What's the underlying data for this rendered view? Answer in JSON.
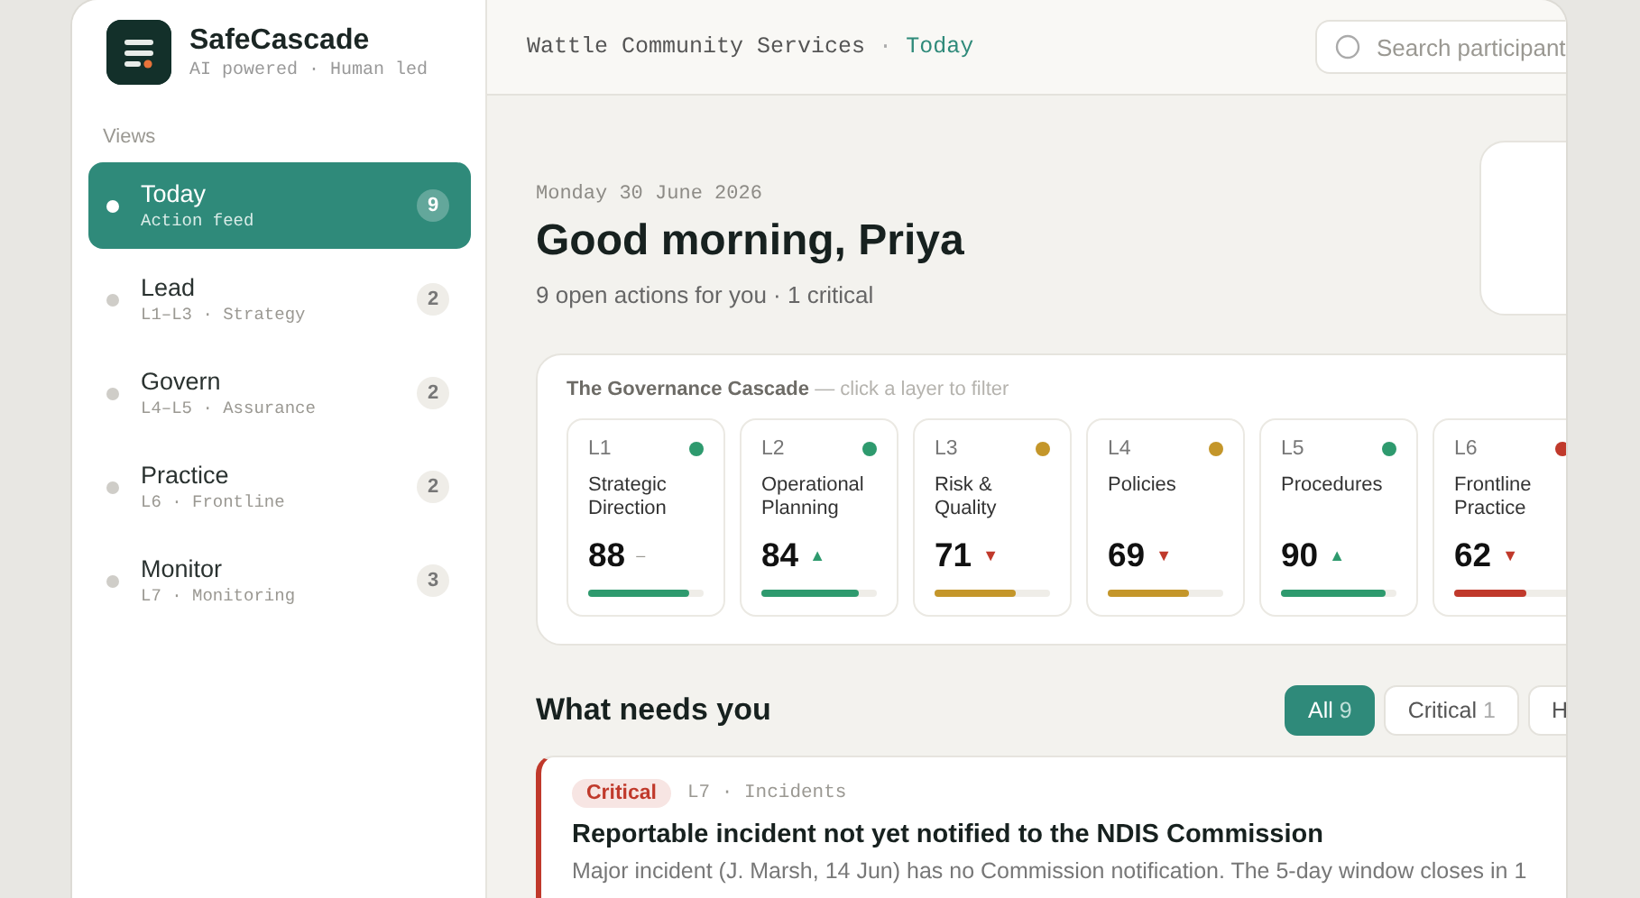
{
  "brand": {
    "name": "SafeCascade",
    "tagline": "AI powered · Human led"
  },
  "sidebar": {
    "heading": "Views",
    "items": [
      {
        "label": "Today",
        "sub": "Action feed",
        "count": "9",
        "selected": true
      },
      {
        "label": "Lead",
        "sub": "L1–L3 · Strategy",
        "count": "2",
        "selected": false
      },
      {
        "label": "Govern",
        "sub": "L4–L5 · Assurance",
        "count": "2",
        "selected": false
      },
      {
        "label": "Practice",
        "sub": "L6 · Frontline",
        "count": "2",
        "selected": false
      },
      {
        "label": "Monitor",
        "sub": "L7 · Monitoring",
        "count": "3",
        "selected": false
      }
    ]
  },
  "header": {
    "org": "Wattle Community Services",
    "separator": "·",
    "view": "Today",
    "search": {
      "placeholder": "Search participant"
    }
  },
  "greeting": {
    "date": "Monday 30 June 2026",
    "title": "Good morning, Priya",
    "summary": "9 open actions for you · 1 critical"
  },
  "cascade": {
    "title": "**The Governance Cascade** — click a layer to filter",
    "layers": [
      {
        "code": "L1",
        "name": "Strategic Direction",
        "score": "88",
        "trend": "–",
        "kind": "flat",
        "color": "#2e9a6e",
        "level": 0.88
      },
      {
        "code": "L2",
        "name": "Operational Planning",
        "score": "84",
        "trend": "▲",
        "kind": "up",
        "color": "#2e9a6e",
        "level": 0.84
      },
      {
        "code": "L3",
        "name": "Risk & Quality",
        "score": "71",
        "trend": "▼",
        "kind": "down",
        "color": "#c4962a",
        "level": 0.71
      },
      {
        "code": "L4",
        "name": "Policies",
        "score": "69",
        "trend": "▼",
        "kind": "down",
        "color": "#c4962a",
        "level": 0.7
      },
      {
        "code": "L5",
        "name": "Procedures",
        "score": "90",
        "trend": "▲",
        "kind": "up",
        "color": "#2e9a6e",
        "level": 0.91
      },
      {
        "code": "L6",
        "name": "Frontline Practice",
        "score": "62",
        "trend": "▼",
        "kind": "down",
        "color": "#c0392b",
        "level": 0.62
      }
    ]
  },
  "feed": {
    "heading": "What needs you",
    "filters": [
      {
        "label": "All",
        "count": "9",
        "selected": true
      },
      {
        "label": "Critical",
        "count": "1",
        "selected": false
      },
      {
        "label": "H",
        "selected": false
      }
    ],
    "items": [
      {
        "kind": "critical",
        "tag": "Critical",
        "meta": "L7 · Incidents",
        "title": "Reportable incident not yet notified to the NDIS Commission",
        "body": "Major incident (J. Marsh, 14 Jun) has no Commission notification. The 5-day window closes in 1"
      }
    ]
  }
}
